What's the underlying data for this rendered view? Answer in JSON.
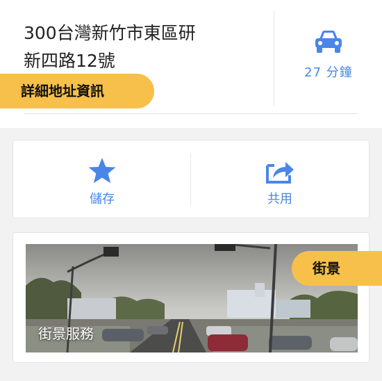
{
  "place": {
    "address_line1": "300台灣新竹市東區研",
    "address_line2": "新四路12號"
  },
  "directions": {
    "icon": "car-icon",
    "drive_time": "27 分鐘",
    "color": "#4a86e8"
  },
  "tags": {
    "address_info": "詳細地址資訊",
    "street_view": "街景"
  },
  "actions": {
    "save": {
      "label": "儲存",
      "icon": "star-icon"
    },
    "share": {
      "label": "共用",
      "icon": "share-icon"
    }
  },
  "street_view": {
    "caption": "街景服務"
  },
  "colors": {
    "accent": "#4a86e8",
    "tag": "#f7c04a"
  }
}
